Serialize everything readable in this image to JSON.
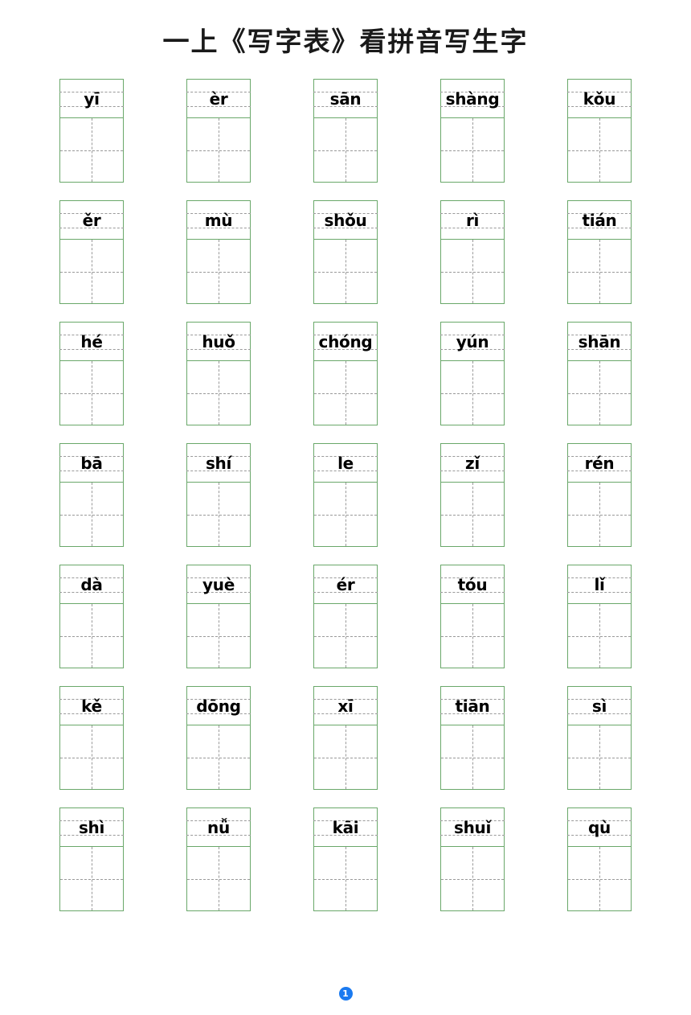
{
  "document": {
    "title": "一上《写字表》看拼音写生字",
    "border_color": "#6aa86a",
    "guide_line_color": "#9a9a9a",
    "page_badge_color": "#1a7af0"
  },
  "worksheet": {
    "columns": 5,
    "rows": 7,
    "total_cells": 35,
    "cells": [
      {
        "pinyin": "yī"
      },
      {
        "pinyin": "èr"
      },
      {
        "pinyin": "sān"
      },
      {
        "pinyin": "shàng"
      },
      {
        "pinyin": "kǒu"
      },
      {
        "pinyin": "ěr"
      },
      {
        "pinyin": "mù"
      },
      {
        "pinyin": "shǒu"
      },
      {
        "pinyin": "rì"
      },
      {
        "pinyin": "tián"
      },
      {
        "pinyin": "hé"
      },
      {
        "pinyin": "huǒ"
      },
      {
        "pinyin": "chóng"
      },
      {
        "pinyin": "yún"
      },
      {
        "pinyin": "shān"
      },
      {
        "pinyin": "bā"
      },
      {
        "pinyin": "shí"
      },
      {
        "pinyin": "le"
      },
      {
        "pinyin": "zǐ"
      },
      {
        "pinyin": "rén"
      },
      {
        "pinyin": "dà"
      },
      {
        "pinyin": "yuè"
      },
      {
        "pinyin": "ér"
      },
      {
        "pinyin": "tóu"
      },
      {
        "pinyin": "lǐ"
      },
      {
        "pinyin": "kě"
      },
      {
        "pinyin": "dōng"
      },
      {
        "pinyin": "xī"
      },
      {
        "pinyin": "tiān"
      },
      {
        "pinyin": "sì"
      },
      {
        "pinyin": "shì"
      },
      {
        "pinyin": "nǚ"
      },
      {
        "pinyin": "kāi"
      },
      {
        "pinyin": "shuǐ"
      },
      {
        "pinyin": "qù"
      }
    ]
  },
  "footer": {
    "page_number": "1"
  }
}
